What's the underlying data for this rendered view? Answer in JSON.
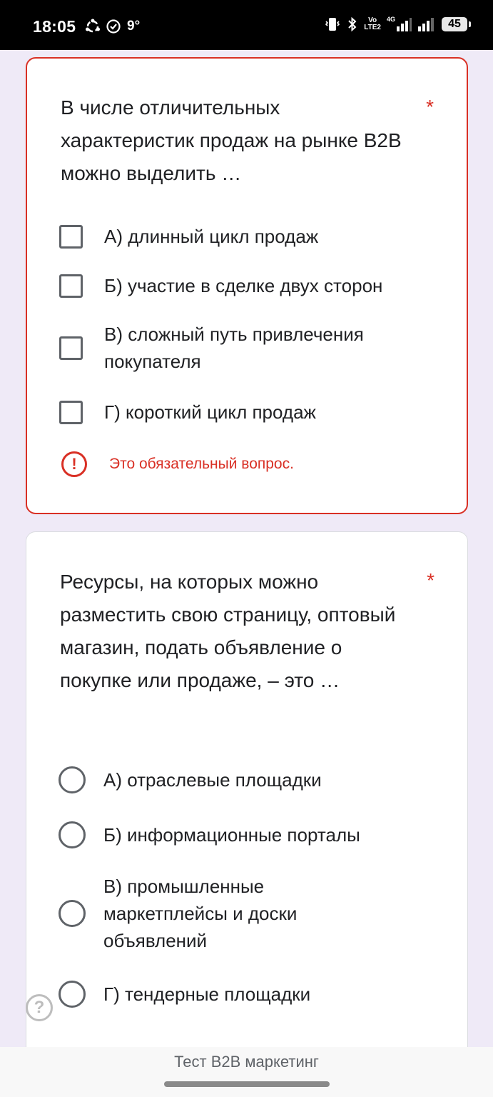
{
  "status_bar": {
    "time": "18:05",
    "temperature": "9°",
    "volte_top": "Vo",
    "volte_bottom": "LTE2",
    "network": "4G",
    "battery": "45"
  },
  "question1": {
    "title": "В числе отличительных характеристик продаж на рынке B2B можно выделить …",
    "required_mark": "*",
    "type": "checkbox",
    "options": [
      {
        "label": "А) длинный цикл продаж",
        "checked": false
      },
      {
        "label": "Б) участие в сделке двух сторон",
        "checked": false
      },
      {
        "label": "В) сложный путь привлечения покупателя",
        "checked": false
      },
      {
        "label": "Г) короткий цикл продаж",
        "checked": false
      }
    ],
    "error_icon": "!",
    "error_text": "Это обязательный вопрос."
  },
  "question2": {
    "title": "Ресурсы, на которых можно разместить свою страницу, оптовый магазин, подать объявление о покупке или продаже, – это …",
    "required_mark": "*",
    "type": "radio",
    "options": [
      {
        "label": "А) отраслевые площадки",
        "selected": false
      },
      {
        "label": "Б) информационные порталы",
        "selected": false
      },
      {
        "label": "В) промышленные маркетплейсы и доски объявлений",
        "selected": false
      },
      {
        "label": "Г) тендерные площадки",
        "selected": false
      }
    ]
  },
  "help_button": {
    "glyph": "?"
  },
  "bottom_bar": {
    "title": "Тест B2B маркетинг"
  },
  "colors": {
    "background": "#efeaf7",
    "error": "#d93025",
    "control_border": "#5f6368"
  }
}
